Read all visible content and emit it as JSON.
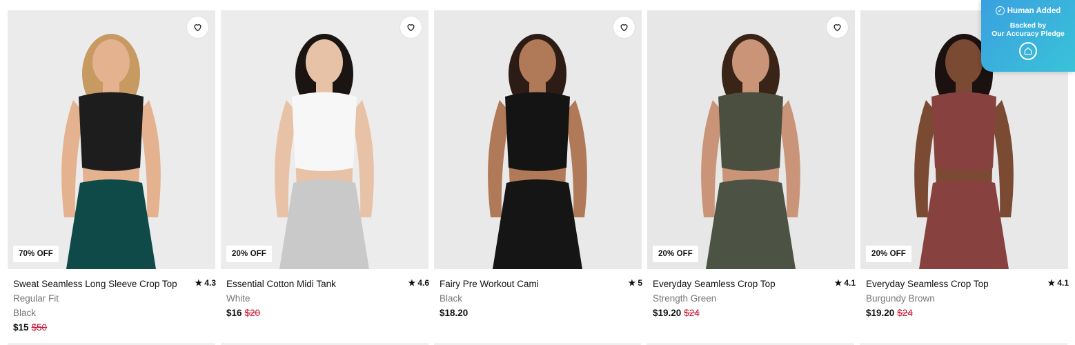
{
  "products": [
    {
      "name": "Sweat Seamless Long Sleeve Crop Top",
      "rating": "4.3",
      "fit": "Regular Fit",
      "color": "Black",
      "price": "$15",
      "was": "$50",
      "badge": "70% OFF",
      "swatch": {
        "top": "#1d1d1d",
        "bottom": "#0f4a48",
        "skin": "#e4b28f",
        "hair": "#c79a62",
        "bg": "#ebebeb"
      }
    },
    {
      "name": "Essential Cotton Midi Tank",
      "rating": "4.6",
      "fit": "",
      "color": "White",
      "price": "$16",
      "was": "$20",
      "badge": "20% OFF",
      "swatch": {
        "top": "#f7f7f7",
        "bottom": "#c9c9c9",
        "skin": "#e7c2a6",
        "hair": "#1a1413",
        "bg": "#ececec"
      }
    },
    {
      "name": "Fairy Pre Workout Cami",
      "rating": "5",
      "fit": "",
      "color": "Black",
      "price": "$18.20",
      "was": "",
      "badge": "",
      "swatch": {
        "top": "#141414",
        "bottom": "#151515",
        "skin": "#b07957",
        "hair": "#2c1c15",
        "bg": "#e9e9e9"
      }
    },
    {
      "name": "Everyday Seamless Crop Top",
      "rating": "4.1",
      "fit": "",
      "color": "Strength Green",
      "price": "$19.20",
      "was": "$24",
      "badge": "20% OFF",
      "swatch": {
        "top": "#4a4f40",
        "bottom": "#4d5344",
        "skin": "#c99477",
        "hair": "#3a2418",
        "bg": "#e7e7e7"
      }
    },
    {
      "name": "Everyday Seamless Crop Top",
      "rating": "4.1",
      "fit": "",
      "color": "Burgundy Brown",
      "price": "$19.20",
      "was": "$24",
      "badge": "20% OFF",
      "swatch": {
        "top": "#874240",
        "bottom": "#874240",
        "skin": "#7a4a32",
        "hair": "#1b1110",
        "bg": "#e8e8e8"
      }
    }
  ],
  "pledge": {
    "title": "Human Added",
    "line1": "Backed by",
    "line2": "Our Accuracy Pledge"
  },
  "icons": {
    "wishlist": "heart-outline-icon",
    "rating": "star-icon",
    "pledge_check": "check-circle-icon",
    "pledge_logo": "house-icon"
  },
  "colors": {
    "sale_red": "#c8102e",
    "muted_text": "#767676",
    "pledge_gradient_start": "#3aa0e0",
    "pledge_gradient_end": "#39c3d8"
  }
}
